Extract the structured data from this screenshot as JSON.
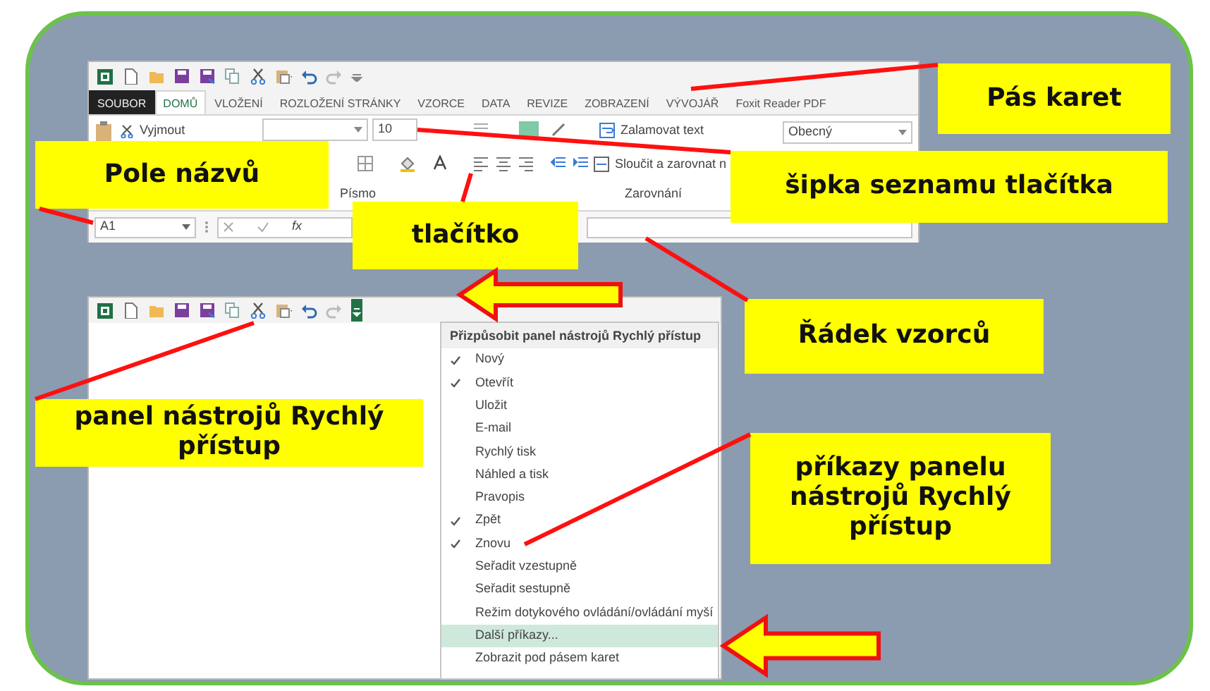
{
  "ribbon": {
    "tabs": [
      {
        "label": "SOUBOR",
        "kind": "backstage",
        "selected": false
      },
      {
        "label": "DOMŮ",
        "kind": "tab",
        "selected": true
      },
      {
        "label": "VLOŽENÍ",
        "kind": "tab",
        "selected": false
      },
      {
        "label": "ROZLOŽENÍ STRÁNKY",
        "kind": "tab",
        "selected": false
      },
      {
        "label": "VZORCE",
        "kind": "tab",
        "selected": false
      },
      {
        "label": "DATA",
        "kind": "tab",
        "selected": false
      },
      {
        "label": "REVIZE",
        "kind": "tab",
        "selected": false
      },
      {
        "label": "ZOBRAZENÍ",
        "kind": "tab",
        "selected": false
      },
      {
        "label": "VÝVOJÁŘ",
        "kind": "tab",
        "selected": false
      },
      {
        "label": "Foxit Reader PDF",
        "kind": "tab",
        "selected": false
      }
    ],
    "cut_label": "Vyjmout",
    "font_size": "10",
    "font_group": "Písmo",
    "wrap_label": "Zalamovat text",
    "merge_label": "Sloučit a zarovnat n",
    "alignment_group": "Zarovnání",
    "number_format": "Obecný"
  },
  "formula_bar": {
    "name_box": "A1",
    "function_label": "fx"
  },
  "quick_access_menu": {
    "title": "Přizpůsobit panel nástrojů Rychlý přístup",
    "items": [
      {
        "label": "Nový",
        "checked": true,
        "selected": false
      },
      {
        "label": "Otevřít",
        "checked": true,
        "selected": false
      },
      {
        "label": "Uložit",
        "checked": false,
        "selected": false
      },
      {
        "label": "E-mail",
        "checked": false,
        "selected": false
      },
      {
        "label": "Rychlý tisk",
        "checked": false,
        "selected": false
      },
      {
        "label": "Náhled a tisk",
        "checked": false,
        "selected": false
      },
      {
        "label": "Pravopis",
        "checked": false,
        "selected": false
      },
      {
        "label": "Zpět",
        "checked": true,
        "selected": false
      },
      {
        "label": "Znovu",
        "checked": true,
        "selected": false
      },
      {
        "label": "Seřadit vzestupně",
        "checked": false,
        "selected": false
      },
      {
        "label": "Seřadit sestupně",
        "checked": false,
        "selected": false
      },
      {
        "label": "Režim dotykového ovládání/ovládání myší",
        "checked": false,
        "selected": false
      },
      {
        "label": "Další příkazy...",
        "checked": false,
        "selected": true
      },
      {
        "label": "Zobrazit pod pásem karet",
        "checked": false,
        "selected": false
      }
    ]
  },
  "callouts": [
    {
      "text": "Pás karet"
    },
    {
      "text": "Pole názvů"
    },
    {
      "text": "šipka seznamu tlačítka"
    },
    {
      "text": "tlačítko"
    },
    {
      "text": "Řádek vzorců"
    },
    {
      "text": "panel nástrojů Rychlý přístup"
    },
    {
      "text": "příkazy panelu nástrojů Rychlý přístup"
    }
  ]
}
